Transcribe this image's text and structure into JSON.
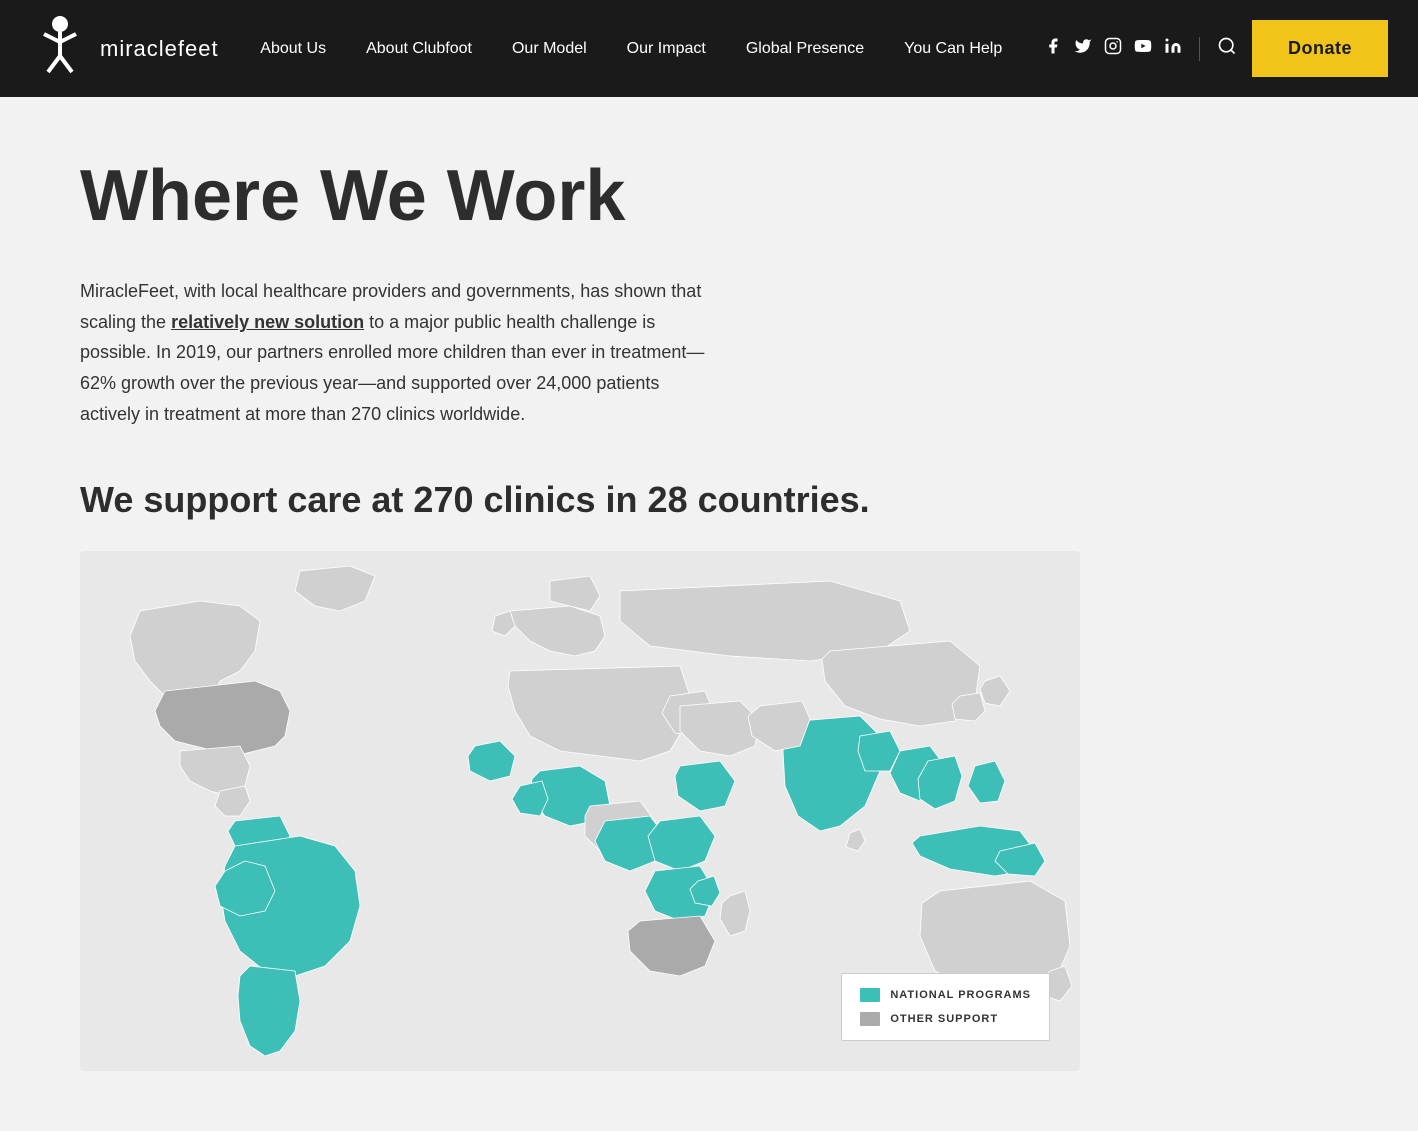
{
  "header": {
    "logo_text": "miraclefeet",
    "donate_label": "Donate",
    "nav_items": [
      {
        "label": "About Us",
        "id": "about-us"
      },
      {
        "label": "About Clubfoot",
        "id": "about-clubfoot"
      },
      {
        "label": "Our Model",
        "id": "our-model"
      },
      {
        "label": "Our Impact",
        "id": "our-impact"
      },
      {
        "label": "Global Presence",
        "id": "global-presence"
      },
      {
        "label": "You Can Help",
        "id": "you-can-help"
      }
    ],
    "social_icons": [
      {
        "name": "facebook-icon",
        "symbol": "f"
      },
      {
        "name": "twitter-icon",
        "symbol": "t"
      },
      {
        "name": "instagram-icon",
        "symbol": "i"
      },
      {
        "name": "youtube-icon",
        "symbol": "y"
      },
      {
        "name": "linkedin-icon",
        "symbol": "in"
      }
    ]
  },
  "main": {
    "page_title": "Where We Work",
    "intro_paragraph": "MiracleFeet, with local healthcare providers and governments, has shown that scaling the ",
    "intro_link_text": "relatively new solution",
    "intro_paragraph_rest": " to a major public health challenge is possible. In 2019, our partners enrolled more children than ever in treatment—62% growth over the previous year—and supported over 24,000 patients actively in treatment at more than 270 clinics worldwide.",
    "clinic_heading": "We support care at 270 clinics in 28 countries.",
    "legend": {
      "items": [
        {
          "label": "National Programs",
          "color": "teal"
        },
        {
          "label": "Other Support",
          "color": "gray"
        }
      ]
    }
  }
}
